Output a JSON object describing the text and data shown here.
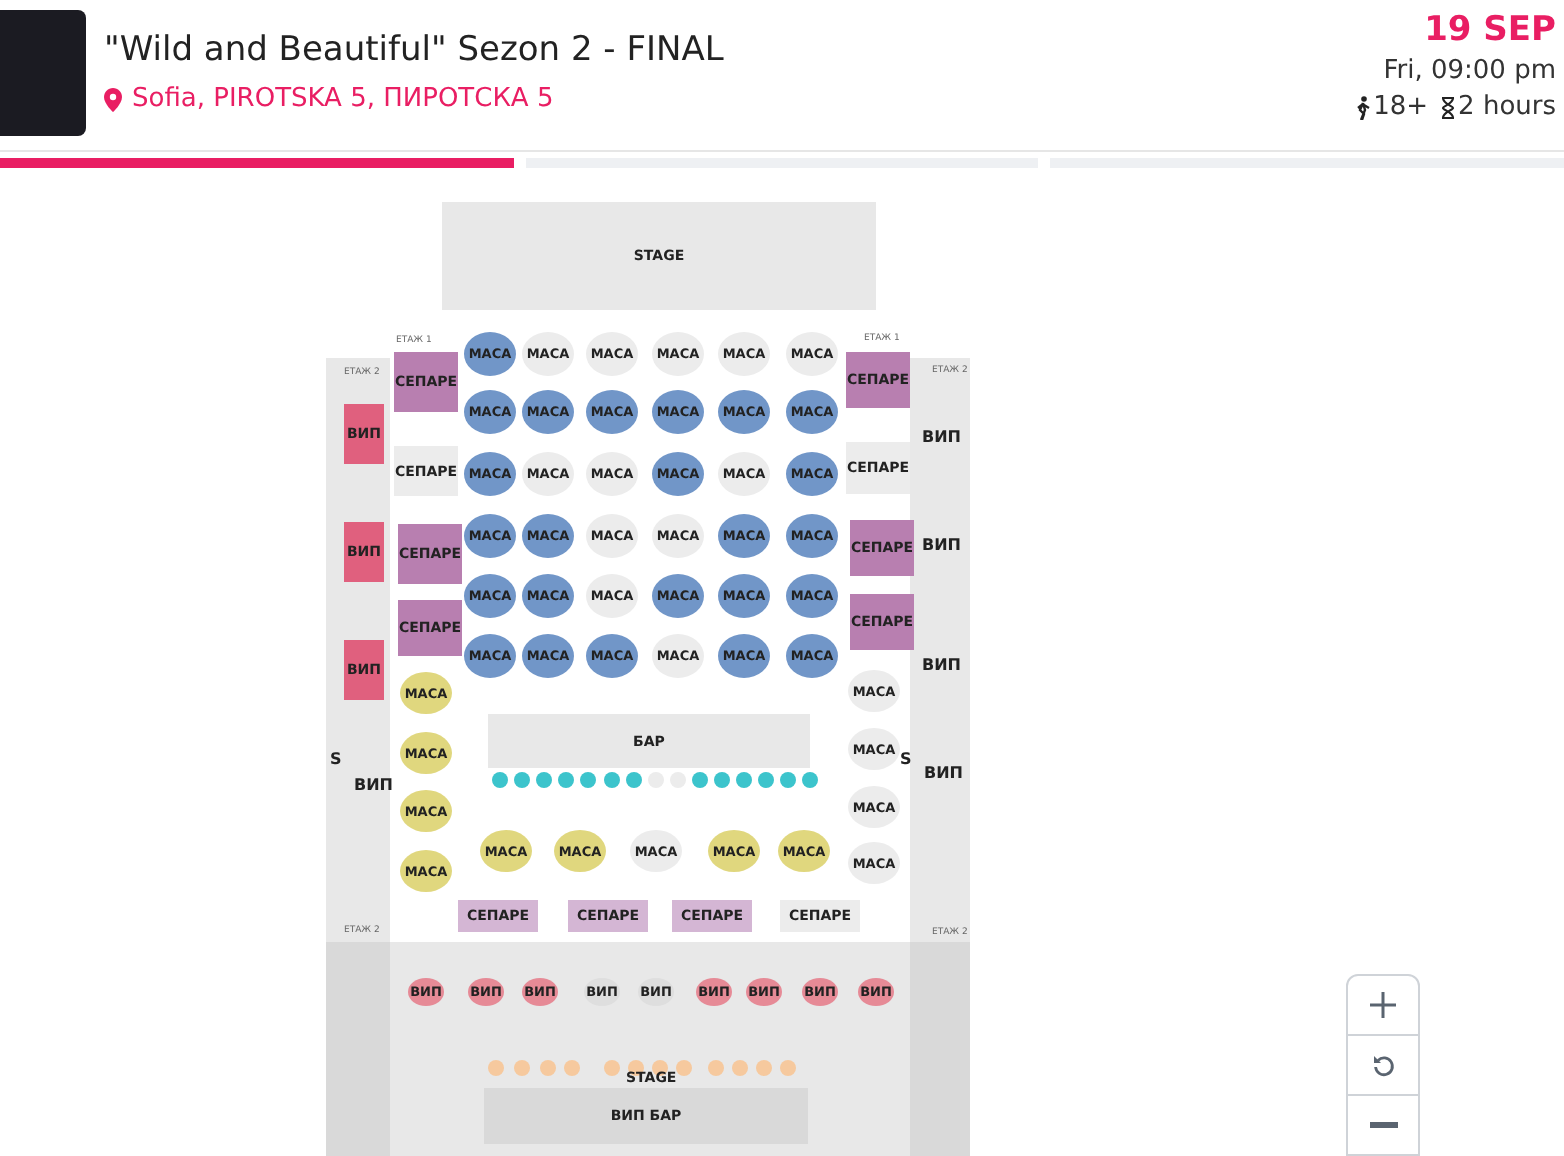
{
  "event": {
    "title": "\"Wild and Beautiful\" Sezon 2 - FINAL",
    "location": "Sofia, PIROTSKA 5, ПИРОТСКА 5",
    "date": "19 SEP",
    "time": "Fri, 09:00 pm",
    "age": "18+",
    "duration": "2 hours"
  },
  "steps": [
    {
      "selected": true
    },
    {
      "selected": false
    },
    {
      "selected": false
    }
  ],
  "map": {
    "stage": "STAGE",
    "floor_labels": [
      "ЕТАЖ 1",
      "ЕТАЖ 1",
      "ЕТАЖ 2",
      "ЕТАЖ 2",
      "ЕТАЖ 2",
      "ЕТАЖ 2"
    ],
    "left_strip": {
      "boxes": [
        {
          "label": "ВИП",
          "color": "#e0607e"
        },
        {
          "label": "ВИП",
          "color": "#e0607e"
        },
        {
          "label": "ВИП",
          "color": "#e0607e"
        }
      ],
      "marks": [
        "S",
        "ВИП"
      ]
    },
    "right_strip": {
      "marks": [
        "ВИП",
        "ВИП",
        "ВИП",
        "S",
        "ВИП"
      ]
    },
    "left_booths": [
      {
        "label": "СЕПАРЕ",
        "color": "#b87fb0"
      },
      {
        "label": "СЕПАРЕ",
        "color": "#ececec"
      },
      {
        "label": "СЕПАРЕ",
        "color": "#b87fb0"
      },
      {
        "label": "СЕПАРЕ",
        "color": "#b87fb0"
      }
    ],
    "right_booths": [
      {
        "label": "СЕПАРЕ",
        "color": "#b87fb0"
      },
      {
        "label": "СЕПАРЕ",
        "color": "#ececec"
      },
      {
        "label": "СЕПАРЕ",
        "color": "#b87fb0"
      },
      {
        "label": "СЕПАРЕ",
        "color": "#b87fb0"
      }
    ],
    "table_rows": [
      [
        {
          "label": "МАСА",
          "color": "#7196c8"
        },
        {
          "label": "МАСА",
          "color": "#ececec"
        },
        {
          "label": "МАСА",
          "color": "#ececec"
        },
        {
          "label": "МАСА",
          "color": "#ececec"
        },
        {
          "label": "МАСА",
          "color": "#ececec"
        },
        {
          "label": "МАСА",
          "color": "#ececec"
        }
      ],
      [
        {
          "label": "МАСА",
          "color": "#7196c8"
        },
        {
          "label": "МАСА",
          "color": "#7196c8"
        },
        {
          "label": "МАСА",
          "color": "#7196c8"
        },
        {
          "label": "МАСА",
          "color": "#7196c8"
        },
        {
          "label": "МАСА",
          "color": "#7196c8"
        },
        {
          "label": "МАСА",
          "color": "#7196c8"
        }
      ],
      [
        {
          "label": "МАСА",
          "color": "#7196c8"
        },
        {
          "label": "МАСА",
          "color": "#ececec"
        },
        {
          "label": "МАСА",
          "color": "#ececec"
        },
        {
          "label": "МАСА",
          "color": "#7196c8"
        },
        {
          "label": "МАСА",
          "color": "#ececec"
        },
        {
          "label": "МАСА",
          "color": "#7196c8"
        }
      ],
      [
        {
          "label": "МАСА",
          "color": "#7196c8"
        },
        {
          "label": "МАСА",
          "color": "#7196c8"
        },
        {
          "label": "МАСА",
          "color": "#ececec"
        },
        {
          "label": "МАСА",
          "color": "#ececec"
        },
        {
          "label": "МАСА",
          "color": "#7196c8"
        },
        {
          "label": "МАСА",
          "color": "#7196c8"
        }
      ],
      [
        {
          "label": "МАСА",
          "color": "#7196c8"
        },
        {
          "label": "МАСА",
          "color": "#7196c8"
        },
        {
          "label": "МАСА",
          "color": "#ececec"
        },
        {
          "label": "МАСА",
          "color": "#7196c8"
        },
        {
          "label": "МАСА",
          "color": "#7196c8"
        },
        {
          "label": "МАСА",
          "color": "#7196c8"
        }
      ],
      [
        {
          "label": "МАСА",
          "color": "#7196c8"
        },
        {
          "label": "МАСА",
          "color": "#7196c8"
        },
        {
          "label": "МАСА",
          "color": "#7196c8"
        },
        {
          "label": "МАСА",
          "color": "#ececec"
        },
        {
          "label": "МАСА",
          "color": "#7196c8"
        },
        {
          "label": "МАСА",
          "color": "#7196c8"
        }
      ]
    ],
    "left_tables": [
      {
        "label": "МАСА",
        "color": "#e0d77e"
      },
      {
        "label": "МАСА",
        "color": "#e0d77e"
      },
      {
        "label": "МАСА",
        "color": "#e0d77e"
      },
      {
        "label": "МАСА",
        "color": "#e0d77e"
      }
    ],
    "right_tables": [
      {
        "label": "МАСА",
        "color": "#ececec"
      },
      {
        "label": "МАСА",
        "color": "#ececec"
      },
      {
        "label": "МАСА",
        "color": "#ececec"
      },
      {
        "label": "МАСА",
        "color": "#ececec"
      }
    ],
    "bar": "БАР",
    "bar_seats": [
      {
        "color": "#3cc4cc"
      },
      {
        "color": "#3cc4cc"
      },
      {
        "color": "#3cc4cc"
      },
      {
        "color": "#3cc4cc"
      },
      {
        "color": "#3cc4cc"
      },
      {
        "color": "#3cc4cc"
      },
      {
        "color": "#3cc4cc"
      },
      {
        "color": "#ececec"
      },
      {
        "color": "#ececec"
      },
      {
        "color": "#3cc4cc"
      },
      {
        "color": "#3cc4cc"
      },
      {
        "color": "#3cc4cc"
      },
      {
        "color": "#3cc4cc"
      },
      {
        "color": "#3cc4cc"
      },
      {
        "color": "#3cc4cc"
      }
    ],
    "middle_tables": [
      {
        "label": "МАСА",
        "color": "#e0d77e"
      },
      {
        "label": "МАСА",
        "color": "#e0d77e"
      },
      {
        "label": "МАСА",
        "color": "#ececec"
      },
      {
        "label": "МАСА",
        "color": "#e0d77e"
      },
      {
        "label": "МАСА",
        "color": "#e0d77e"
      }
    ],
    "bottom_booths": [
      {
        "label": "СЕПАРЕ",
        "color": "#d4b6d4"
      },
      {
        "label": "СЕПАРЕ",
        "color": "#d4b6d4"
      },
      {
        "label": "СЕПАРЕ",
        "color": "#d4b6d4"
      },
      {
        "label": "СЕПАРЕ",
        "color": "#ececec"
      }
    ],
    "vip_tables": [
      {
        "label": "ВИП",
        "color": "#e68a96"
      },
      {
        "label": "ВИП",
        "color": "#e68a96"
      },
      {
        "label": "ВИП",
        "color": "#e68a96"
      },
      {
        "label": "ВИП",
        "color": "#dedede"
      },
      {
        "label": "ВИП",
        "color": "#dedede"
      },
      {
        "label": "ВИП",
        "color": "#e68a96"
      },
      {
        "label": "ВИП",
        "color": "#e68a96"
      },
      {
        "label": "ВИП",
        "color": "#e68a96"
      },
      {
        "label": "ВИП",
        "color": "#e68a96"
      }
    ],
    "vip_seats": [
      {
        "color": "#f6c99e"
      },
      {
        "color": "#f6c99e"
      },
      {
        "color": "#f6c99e"
      },
      {
        "color": "#f6c99e"
      },
      {
        "color": "#f6c99e"
      },
      {
        "color": "#f6c99e"
      },
      {
        "color": "#f6c99e"
      },
      {
        "color": "#f6c99e"
      },
      {
        "color": "#f6c99e"
      },
      {
        "color": "#f6c99e"
      },
      {
        "color": "#f6c99e"
      },
      {
        "color": "#f6c99e"
      }
    ],
    "vip_stage": "STAGE",
    "vip_bar": "ВИП БАР"
  }
}
